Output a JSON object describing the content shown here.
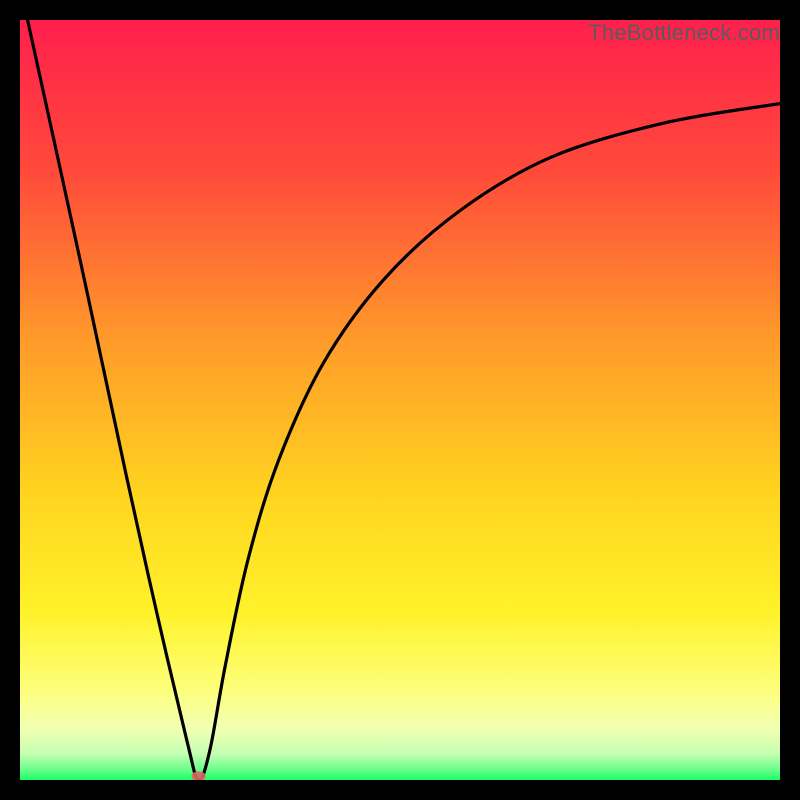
{
  "watermark": "TheBottleneck.com",
  "chart_data": {
    "type": "line",
    "title": "",
    "xlabel": "",
    "ylabel": "",
    "xlim": [
      0,
      100
    ],
    "ylim": [
      0,
      100
    ],
    "grid": false,
    "legend": false,
    "notes": "Single V-shaped curve over a vertical gradient (red→orange→yellow→green). Left branch is nearly linear from top-left to the minimum; right branch rises with decreasing slope. No tick labels or numeric annotations are visible.",
    "series": [
      {
        "name": "curve",
        "x": [
          1,
          8,
          14,
          18,
          22,
          23.5,
          25,
          27,
          30,
          34,
          40,
          48,
          58,
          70,
          85,
          100
        ],
        "y": [
          100,
          68,
          40,
          22,
          5,
          0,
          4,
          15,
          29,
          42,
          55,
          66,
          75,
          82,
          86.5,
          89
        ]
      }
    ],
    "marker": {
      "x": 23.5,
      "y": 0.5,
      "color": "#d66"
    },
    "gradient_stops": [
      {
        "offset": 0.0,
        "color": "#ff1f4d"
      },
      {
        "offset": 0.2,
        "color": "#ff4a3a"
      },
      {
        "offset": 0.42,
        "color": "#ff9a2a"
      },
      {
        "offset": 0.62,
        "color": "#ffd31f"
      },
      {
        "offset": 0.78,
        "color": "#fff22a"
      },
      {
        "offset": 0.88,
        "color": "#fdff7a"
      },
      {
        "offset": 0.93,
        "color": "#f3ffb0"
      },
      {
        "offset": 0.965,
        "color": "#c7ffb3"
      },
      {
        "offset": 0.985,
        "color": "#6fff8d"
      },
      {
        "offset": 1.0,
        "color": "#1aff66"
      }
    ]
  }
}
